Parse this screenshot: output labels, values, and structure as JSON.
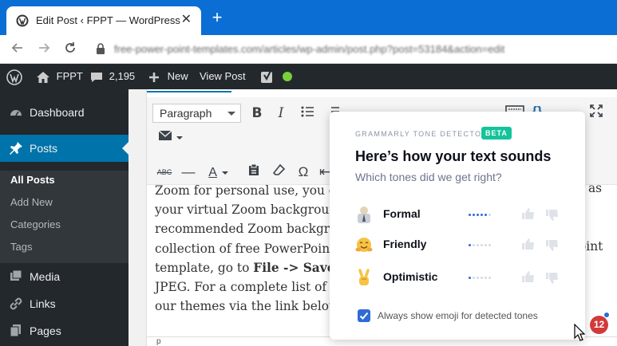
{
  "browser": {
    "tab_title": "Edit Post ‹ FPPT — WordPress",
    "tab_close": "✕",
    "new_tab": "+",
    "url": "free-power-point-templates.com/articles/wp-admin/post.php?post=53184&action=edit"
  },
  "adminbar": {
    "site_name": "FPPT",
    "comments_count": "2,195",
    "new_label": "New",
    "view_post_label": "View Post",
    "status_color": "#7ad03a"
  },
  "sidebar": {
    "items": [
      {
        "label": "Dashboard",
        "icon": "dashboard-icon"
      },
      {
        "label": "Posts",
        "icon": "pin-icon"
      },
      {
        "label": "Media",
        "icon": "media-icon"
      },
      {
        "label": "Links",
        "icon": "links-icon"
      },
      {
        "label": "Pages",
        "icon": "pages-icon"
      }
    ],
    "submenu": [
      "All Posts",
      "Add New",
      "Categories",
      "Tags"
    ]
  },
  "editor": {
    "format": "Paragraph",
    "lines": [
      "Zoom for personal use, you can",
      "your virtual Zoom background.",
      "recommended Zoom backgrou",
      "collection of free PowerPoint te",
      "template, go to ",
      "JPEG. For a complete list of fre",
      "our themes via the link below."
    ],
    "bold_fragment": "File -> Save A",
    "right_edge_fragments": [
      "as",
      "",
      "",
      "oint",
      "",
      "",
      ""
    ],
    "status_text": "p"
  },
  "grammarly": {
    "kicker": "GRAMMARLY TONE DETECTOR",
    "beta": "BETA",
    "title": "Here’s how your text sounds",
    "subtitle": "Which tones did we get right?",
    "tones": [
      {
        "name": "Formal",
        "emoji": "person-in-suit-icon",
        "level": 5
      },
      {
        "name": "Friendly",
        "emoji": "hugging-face-icon",
        "level": 1
      },
      {
        "name": "Optimistic",
        "emoji": "victory-hand-icon",
        "level": 1
      }
    ],
    "meter_max": 6,
    "checkbox_label": "Always show emoji for detected tones",
    "checkbox_checked": true,
    "badge_count": "12",
    "accent": "#2f6bd6",
    "beta_color": "#15c39a"
  }
}
